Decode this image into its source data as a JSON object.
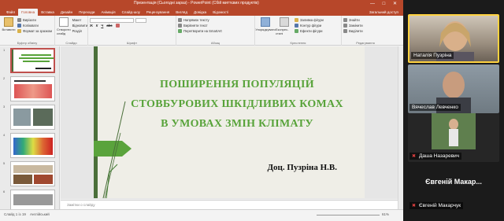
{
  "window": {
    "title": "Презентація (Сьогодні зараз) - PowerPoint (Сбій миттєвих продуктів)",
    "controls": "— □ ✕"
  },
  "tabs": [
    "Файл",
    "Головна",
    "Вставка",
    "Дизайн",
    "Переходи",
    "Анімація",
    "Слайд-шоу",
    "Рецензування",
    "Вигляд",
    "Довідка",
    "Відомості"
  ],
  "tabs_right": "Загальний доступ",
  "ribbon": {
    "clipboard": {
      "paste": "Вставити",
      "cut": "Вирізати",
      "copy": "Копіювати",
      "format": "Формат за зразком",
      "label": "Буфер обміну"
    },
    "slides": {
      "new": "Створити слайд",
      "layout": "Макет",
      "reset": "Відновити",
      "section": "Розділ",
      "label": "Слайди"
    },
    "font": {
      "label": "Шрифт"
    },
    "paragraph": {
      "dir": "Напрямок тексту",
      "align": "Вирівняти текст",
      "smart": "Перетворити на SmartArt",
      "label": "Абзац"
    },
    "drawing": {
      "arrange": "Упорядкувати",
      "styles": "Експрес-стилі",
      "fill": "Заливка фігури",
      "outline": "Контур фігури",
      "effects": "Ефекти фігури",
      "label": "Креслення"
    },
    "editing": {
      "find": "Знайти",
      "replace": "Замінити",
      "select": "Виділити",
      "label": "Редагування"
    }
  },
  "slide": {
    "heading_lines": [
      "ПОШИРЕННЯ ПОПУЛЯЦІЙ",
      "СТОВБУРОВИХ ШКІДЛИВИХ КОМАХ",
      "В УМОВАХ ЗМІН КЛІМАТУ"
    ],
    "author": "Доц. Пузріна Н.В."
  },
  "thumbnails": [
    "1",
    "2",
    "3",
    "4",
    "5",
    "6"
  ],
  "notes_placeholder": "Замітки о слайду",
  "status": {
    "slide": "Слайд 1 із 19",
    "lang": "Англійський",
    "zoom": "61%"
  },
  "participants": [
    {
      "name": "Наталія Пузріна",
      "type": "video",
      "muted": false,
      "active": true
    },
    {
      "name": "Вячеслав Левченко",
      "type": "video",
      "muted": false,
      "active": false
    },
    {
      "name": "Даша Назаревич",
      "type": "video",
      "muted": true,
      "active": false
    },
    {
      "name": "Євгеній Макарчук",
      "type": "avatar",
      "display": "Євгеній Макар...",
      "muted": true,
      "active": false
    }
  ],
  "colors": {
    "ppt_accent": "#b7472a",
    "title_green": "#58a33a",
    "active_speaker": "#ffd23f"
  }
}
